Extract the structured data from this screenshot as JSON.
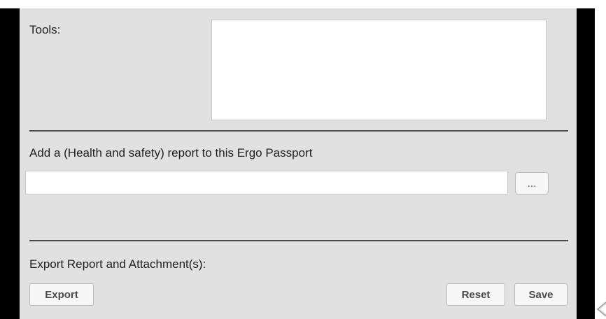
{
  "form": {
    "tools_label": "Tools:",
    "tools_value": "",
    "report_label": "Add a (Health and safety) report to this Ergo Passport",
    "report_value": "",
    "browse_label": "...",
    "export_label": "Export Report and Attachment(s):"
  },
  "actions": {
    "export": "Export",
    "reset": "Reset",
    "save": "Save"
  },
  "icons": {
    "corner": "chevron-left-icon"
  },
  "colors": {
    "panel_background": "#e1e1e1",
    "border": "#000000",
    "text": "#1f1f1f"
  }
}
